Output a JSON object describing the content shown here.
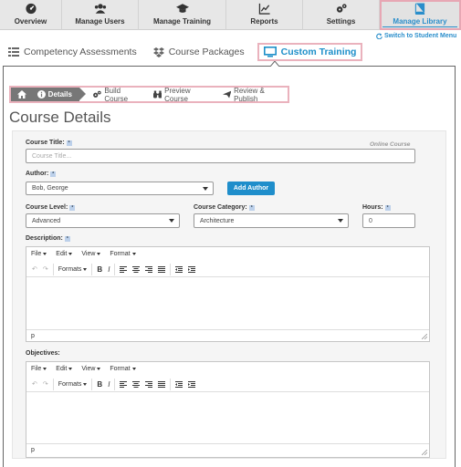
{
  "nav": {
    "items": [
      {
        "label": "Overview",
        "icon": "dashboard-icon"
      },
      {
        "label": "Manage Users",
        "icon": "users-icon"
      },
      {
        "label": "Manage Training",
        "icon": "graduation-cap-icon"
      },
      {
        "label": "Reports",
        "icon": "line-chart-icon"
      },
      {
        "label": "Settings",
        "icon": "gears-icon"
      },
      {
        "label": "Manage Library",
        "icon": "book-icon"
      }
    ],
    "switch_link": "Switch to Student Menu"
  },
  "tabs": [
    {
      "label": "Competency Assessments",
      "icon": "list-icon"
    },
    {
      "label": "Course Packages",
      "icon": "dropbox-icon"
    },
    {
      "label": "Custom Training",
      "icon": "monitor-icon"
    }
  ],
  "breadcrumb": {
    "active": "Details",
    "steps": [
      "Build Course",
      "Preview Course",
      "Review & Publish"
    ]
  },
  "page_title": "Course Details",
  "form": {
    "online_label": "Online Course",
    "course_title": {
      "label": "Course Title:",
      "placeholder": "Course Title..."
    },
    "author": {
      "label": "Author:",
      "value": "Bob, George",
      "button": "Add Author"
    },
    "course_level": {
      "label": "Course Level:",
      "value": "Advanced"
    },
    "course_category": {
      "label": "Course Category:",
      "value": "Architecture"
    },
    "hours": {
      "label": "Hours:",
      "value": "0"
    },
    "description": {
      "label": "Description:"
    },
    "objectives": {
      "label": "Objectives:"
    }
  },
  "editor": {
    "menus": [
      "File",
      "Edit",
      "View",
      "Format"
    ],
    "formats": "Formats",
    "status": "p"
  },
  "colors": {
    "accent": "#1f8ecb",
    "highlight_border": "#eab2bd"
  }
}
